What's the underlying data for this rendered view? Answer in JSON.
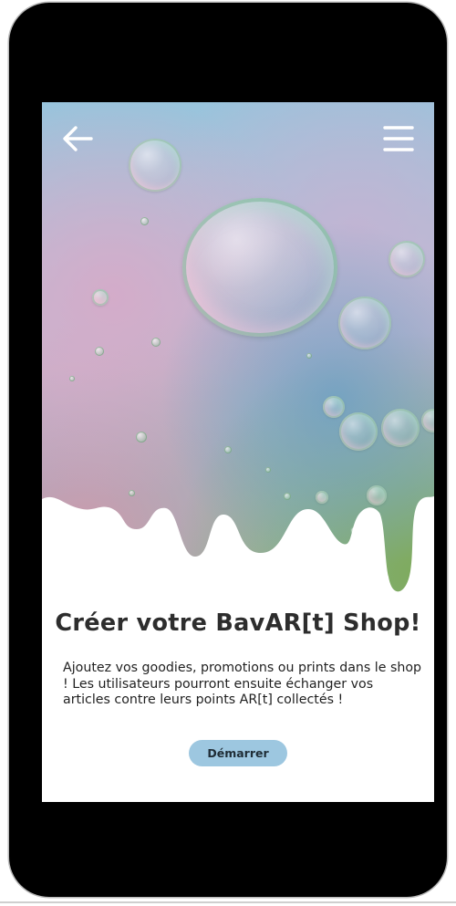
{
  "screen": {
    "title": "Créer votre BavAR[t] Shop!",
    "description": "Ajoutez vos goodies, promotions ou prints dans le shop ! Les utilisateurs pourront ensuite échanger vos articles contre leurs points AR[t] collectés !",
    "cta_label": "Démarrer"
  },
  "icons": {
    "back": "arrow-left-icon",
    "menu": "hamburger-menu-icon"
  },
  "colors": {
    "cta_background": "#9dc7e0",
    "title_text": "#2d2d2d",
    "phone_frame": "#000000"
  }
}
